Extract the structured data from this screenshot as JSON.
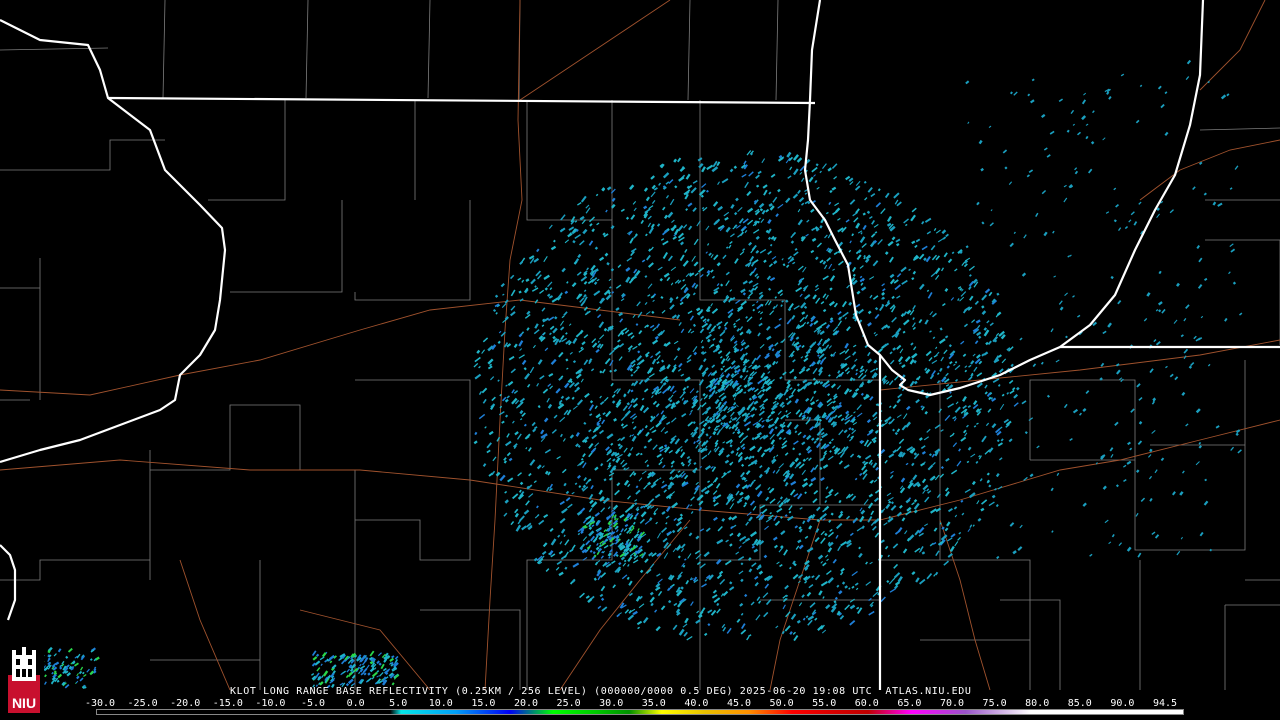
{
  "product": {
    "caption": "KLOT LONG RANGE BASE REFLECTIVITY (0.25KM / 256 LEVEL) (000000/0000 0.5 DEG) 2025-06-20 19:08 UTC  ATLAS.NIU.EDU"
  },
  "color_scale": {
    "labels": [
      "-30.0",
      "-25.0",
      "-20.0",
      "-15.0",
      "-10.0",
      "-5.0",
      "0.0",
      "5.0",
      "10.0",
      "15.0",
      "20.0",
      "25.0",
      "30.0",
      "35.0",
      "40.0",
      "45.0",
      "50.0",
      "55.0",
      "60.0",
      "65.0",
      "70.0",
      "75.0",
      "80.0",
      "85.0",
      "90.0",
      "94.5"
    ],
    "colors": [
      "#000000",
      "#000000",
      "#000000",
      "#000000",
      "#000000",
      "#000000",
      "#05e6e6",
      "#01a0f6",
      "#0000f6",
      "#00ff00",
      "#00c800",
      "#009000",
      "#ffff00",
      "#e7c000",
      "#ff9000",
      "#ff0000",
      "#d60000",
      "#c00000",
      "#ff00ff",
      "#9955c9",
      "#ffffff",
      "#ffffff"
    ]
  },
  "logo": {
    "text": "NIU",
    "color": "#c8102e"
  },
  "map_colors": {
    "state_border": "#ffffff",
    "county_line": "#8a8a8a",
    "highway": "#a0522d",
    "echo_primary": "#1fb5c8",
    "echo_secondary": "#1e7fd8"
  }
}
